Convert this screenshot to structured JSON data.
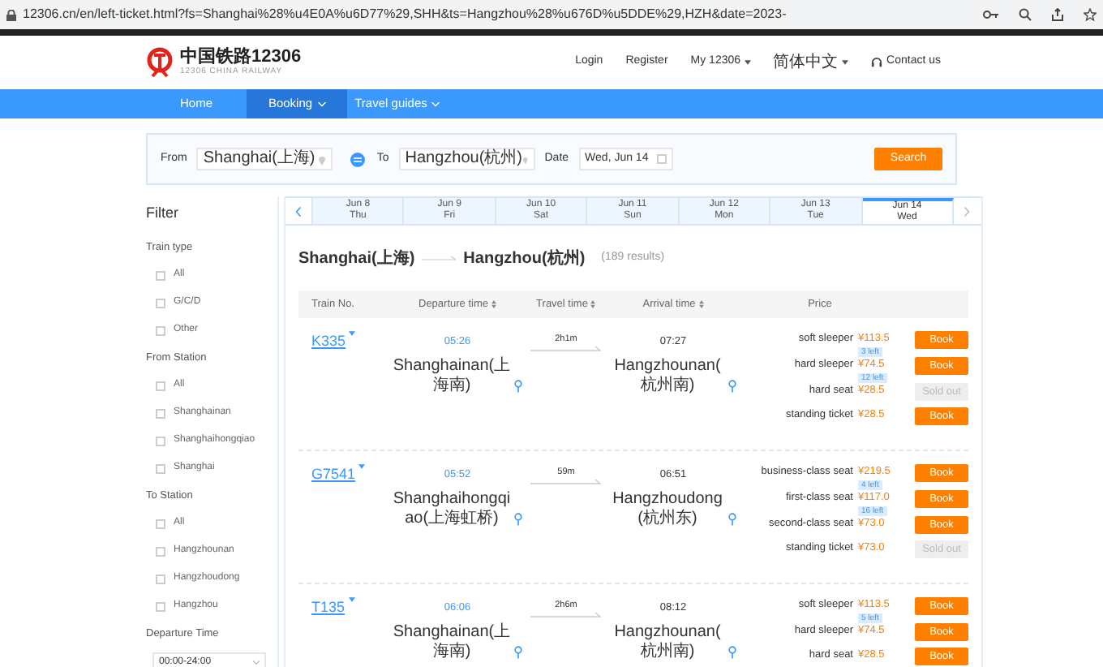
{
  "browser": {
    "url": "12306.cn/en/left-ticket.html?fs=Shanghai%28%u4E0A%u6D77%29,SHH&ts=Hangzhou%28%u676D%u5DDE%29,HZH&date=2023-"
  },
  "header": {
    "logo_title": "中国铁路12306",
    "logo_subtitle": "12306 CHINA RAILWAY",
    "links": [
      {
        "label": "Login",
        "kind": "text"
      },
      {
        "label": "Register",
        "kind": "text"
      },
      {
        "label": "My 12306",
        "kind": "dropdown"
      },
      {
        "label": "简体中文",
        "kind": "dropdown"
      },
      {
        "label": "Contact us",
        "kind": "contact"
      }
    ]
  },
  "nav": [
    {
      "label": "Home",
      "selected": false,
      "dropdown": false
    },
    {
      "label": "Booking",
      "selected": true,
      "dropdown": true
    },
    {
      "label": "Travel guides",
      "selected": false,
      "dropdown": true
    }
  ],
  "search": {
    "from_label": "From",
    "from_value": "Shanghai(上海)",
    "to_label": "To",
    "to_value": "Hangzhou(杭州)",
    "date_label": "Date",
    "date_value": "Wed, Jun 14",
    "button": "Search"
  },
  "filter": {
    "title": "Filter",
    "groups": [
      {
        "title": "Train type",
        "kind": "checkboxes",
        "options": [
          {
            "label": "All",
            "checked": false
          },
          {
            "label": "G/C/D",
            "checked": false
          },
          {
            "label": "Other",
            "checked": false
          }
        ]
      },
      {
        "title": "From Station",
        "kind": "checkboxes",
        "options": [
          {
            "label": "All",
            "checked": false
          },
          {
            "label": "Shanghainan",
            "checked": false
          },
          {
            "label": "Shanghaihongqiao",
            "checked": false
          },
          {
            "label": "Shanghai",
            "checked": false
          }
        ]
      },
      {
        "title": "To Station",
        "kind": "checkboxes",
        "options": [
          {
            "label": "All",
            "checked": false
          },
          {
            "label": "Hangzhounan",
            "checked": false
          },
          {
            "label": "Hangzhoudong",
            "checked": false
          },
          {
            "label": "Hangzhou",
            "checked": false
          }
        ]
      },
      {
        "title": "Departure Time",
        "kind": "select",
        "value": "00:00-24:00"
      }
    ]
  },
  "dates": [
    {
      "date": "Jun 8",
      "day": "Thu",
      "selected": false
    },
    {
      "date": "Jun 9",
      "day": "Fri",
      "selected": false
    },
    {
      "date": "Jun 10",
      "day": "Sat",
      "selected": false
    },
    {
      "date": "Jun 11",
      "day": "Sun",
      "selected": false
    },
    {
      "date": "Jun 12",
      "day": "Mon",
      "selected": false
    },
    {
      "date": "Jun 13",
      "day": "Tue",
      "selected": false
    },
    {
      "date": "Jun 14",
      "day": "Wed",
      "selected": true
    }
  ],
  "results": {
    "from": "Shanghai(上海)",
    "to": "Hangzhou(杭州)",
    "count": "(189 results)"
  },
  "columns": [
    {
      "label": "Train No.",
      "sortable": false
    },
    {
      "label": "Departure time",
      "sortable": true
    },
    {
      "label": "Travel time",
      "sortable": true
    },
    {
      "label": "Arrival time",
      "sortable": true
    },
    {
      "label": "Price",
      "sortable": false
    }
  ],
  "trains": [
    {
      "number": "K335",
      "depart_time": "05:26",
      "depart_station": "Shanghainan(上海南)",
      "duration": "2h1m",
      "arrive_time": "07:27",
      "arrive_station": "Hangzhounan(杭州南)",
      "seats": [
        {
          "name": "soft sleeper",
          "price": "¥113.5",
          "left": "3 left",
          "button": {
            "label": "Book",
            "kind": "book"
          }
        },
        {
          "name": "hard sleeper",
          "price": "¥74.5",
          "left": "12 left",
          "button": {
            "label": "Book",
            "kind": "book"
          }
        },
        {
          "name": "hard seat",
          "price": "¥28.5",
          "button": {
            "label": "Sold out",
            "kind": "soldout"
          }
        },
        {
          "name": "standing ticket",
          "price": "¥28.5",
          "button": {
            "label": "Book",
            "kind": "book"
          }
        }
      ]
    },
    {
      "number": "G7541",
      "depart_time": "05:52",
      "depart_station": "Shanghaihongqiao(上海虹桥)",
      "duration": "59m",
      "arrive_time": "06:51",
      "arrive_station": "Hangzhoudong(杭州东)",
      "seats": [
        {
          "name": "business-class seat",
          "price": "¥219.5",
          "left": "4 left",
          "button": {
            "label": "Book",
            "kind": "book"
          }
        },
        {
          "name": "first-class seat",
          "price": "¥117.0",
          "left": "16 left",
          "button": {
            "label": "Book",
            "kind": "book"
          }
        },
        {
          "name": "second-class seat",
          "price": "¥73.0",
          "button": {
            "label": "Book",
            "kind": "book"
          }
        },
        {
          "name": "standing ticket",
          "price": "¥73.0",
          "button": {
            "label": "Sold out",
            "kind": "soldout"
          }
        }
      ]
    },
    {
      "number": "T135",
      "depart_time": "06:06",
      "depart_station": "Shanghainan(上海南)",
      "duration": "2h6m",
      "arrive_time": "08:12",
      "arrive_station": "Hangzhounan(杭州南)",
      "seats": [
        {
          "name": "soft sleeper",
          "price": "¥113.5",
          "left": "5 left",
          "button": {
            "label": "Book",
            "kind": "book"
          }
        },
        {
          "name": "hard sleeper",
          "price": "¥74.5",
          "button": {
            "label": "Book",
            "kind": "book"
          }
        },
        {
          "name": "hard seat",
          "price": "¥28.5",
          "button": {
            "label": "Book",
            "kind": "book"
          }
        }
      ]
    }
  ]
}
